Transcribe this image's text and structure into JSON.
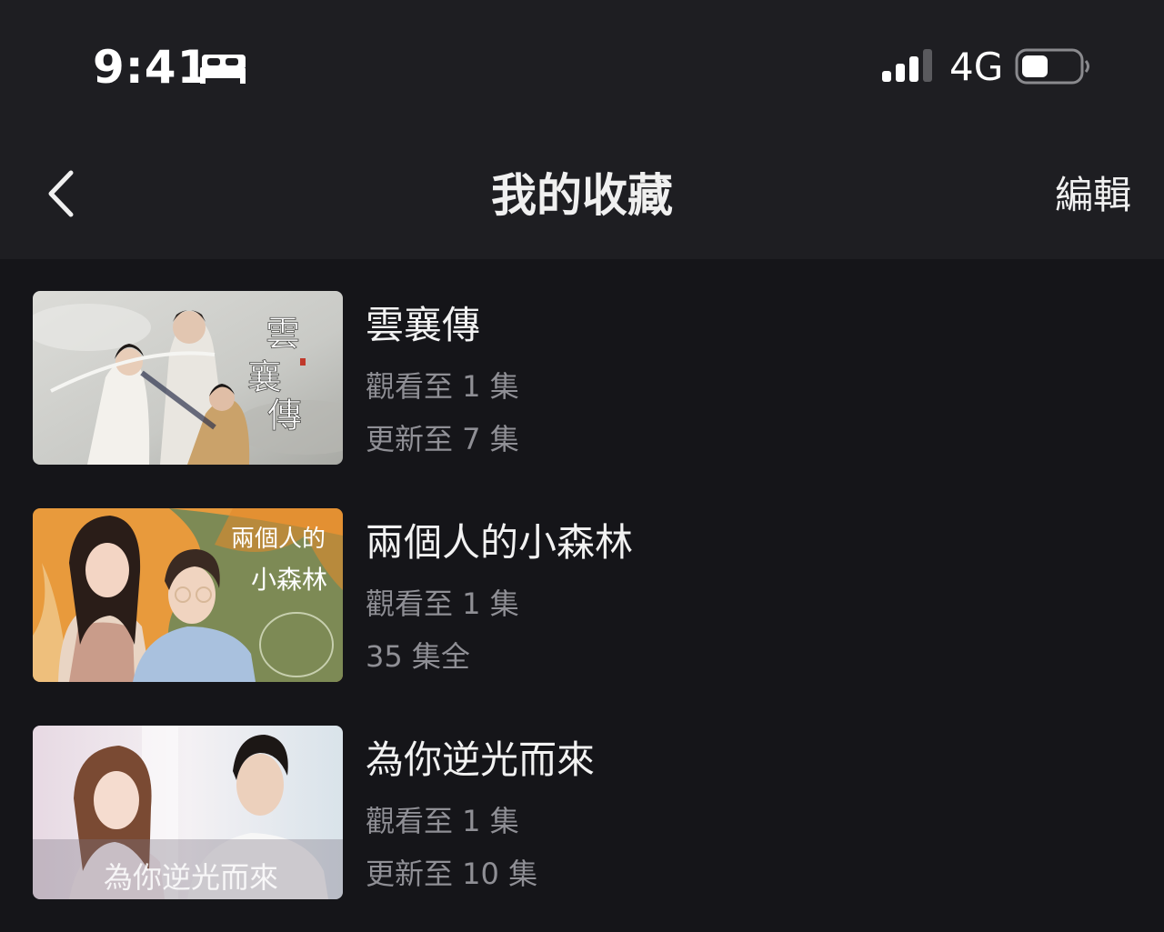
{
  "status_bar": {
    "time": "9:41",
    "network": "4G",
    "icons": [
      "sleep-icon",
      "signal-icon",
      "battery-icon"
    ]
  },
  "nav": {
    "title": "我的收藏",
    "edit_label": "編輯",
    "back_icon": "chevron-left-icon"
  },
  "favorites": [
    {
      "title": "雲襄傳",
      "watched": "觀看至 1 集",
      "status": "更新至 7 集",
      "poster_text": "雲襄傳"
    },
    {
      "title": "兩個人的小森林",
      "watched": "觀看至 1 集",
      "status": "35 集全",
      "poster_text": "兩個人的小森林"
    },
    {
      "title": "為你逆光而來",
      "watched": "觀看至 1 集",
      "status": "更新至 10 集",
      "poster_text": "為你逆光而來"
    }
  ],
  "colors": {
    "background": "#151519",
    "bar": "#1e1e22",
    "title_text": "#f2f2f2",
    "meta_text": "#8f8f95"
  }
}
